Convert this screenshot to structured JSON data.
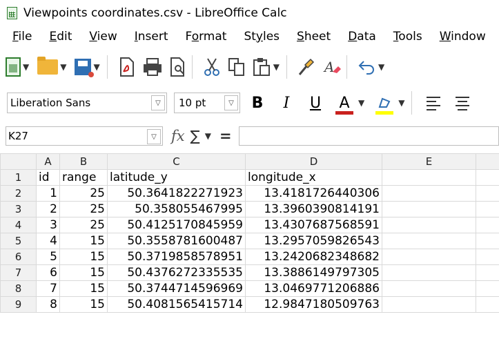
{
  "window": {
    "title": "Viewpoints coordinates.csv - LibreOffice Calc"
  },
  "menu": [
    {
      "pre": "",
      "ul": "F",
      "post": "ile"
    },
    {
      "pre": "",
      "ul": "E",
      "post": "dit"
    },
    {
      "pre": "",
      "ul": "V",
      "post": "iew"
    },
    {
      "pre": "",
      "ul": "I",
      "post": "nsert"
    },
    {
      "pre": "F",
      "ul": "o",
      "post": "rmat"
    },
    {
      "pre": "St",
      "ul": "y",
      "post": "les"
    },
    {
      "pre": "",
      "ul": "S",
      "post": "heet"
    },
    {
      "pre": "",
      "ul": "D",
      "post": "ata"
    },
    {
      "pre": "",
      "ul": "T",
      "post": "ools"
    },
    {
      "pre": "",
      "ul": "W",
      "post": "indow"
    }
  ],
  "toolbar": {
    "font_name": "Liberation Sans",
    "font_size": "10 pt",
    "bold": "B",
    "italic": "I",
    "underline": "U",
    "font_color_glyph": "A",
    "font_color": "#c9211e",
    "highlight_color": "#ffff00"
  },
  "formula_bar": {
    "name_box": "K27",
    "fx": "fx",
    "sum": "∑",
    "equals": "=",
    "content": ""
  },
  "sheet": {
    "columns": [
      "A",
      "B",
      "C",
      "D",
      "E"
    ],
    "rows": [
      {
        "n": "1",
        "a": "id",
        "b": "range",
        "c": "latitude_y",
        "d": "longitude_x",
        "e": ""
      },
      {
        "n": "2",
        "a": "1",
        "b": "25",
        "c": "50.3641822271923",
        "d": "13.4181726440306",
        "e": ""
      },
      {
        "n": "3",
        "a": "2",
        "b": "25",
        "c": "50.358055467995",
        "d": "13.3960390814191",
        "e": ""
      },
      {
        "n": "4",
        "a": "3",
        "b": "25",
        "c": "50.4125170845959",
        "d": "13.4307687568591",
        "e": ""
      },
      {
        "n": "5",
        "a": "4",
        "b": "15",
        "c": "50.3558781600487",
        "d": "13.2957059826543",
        "e": ""
      },
      {
        "n": "6",
        "a": "5",
        "b": "15",
        "c": "50.3719858578951",
        "d": "13.2420682348682",
        "e": ""
      },
      {
        "n": "7",
        "a": "6",
        "b": "15",
        "c": "50.4376272335535",
        "d": "13.3886149797305",
        "e": ""
      },
      {
        "n": "8",
        "a": "7",
        "b": "15",
        "c": "50.3744714596969",
        "d": "13.0469771206886",
        "e": ""
      },
      {
        "n": "9",
        "a": "8",
        "b": "15",
        "c": "50.4081565415714",
        "d": "12.9847180509763",
        "e": ""
      }
    ]
  }
}
